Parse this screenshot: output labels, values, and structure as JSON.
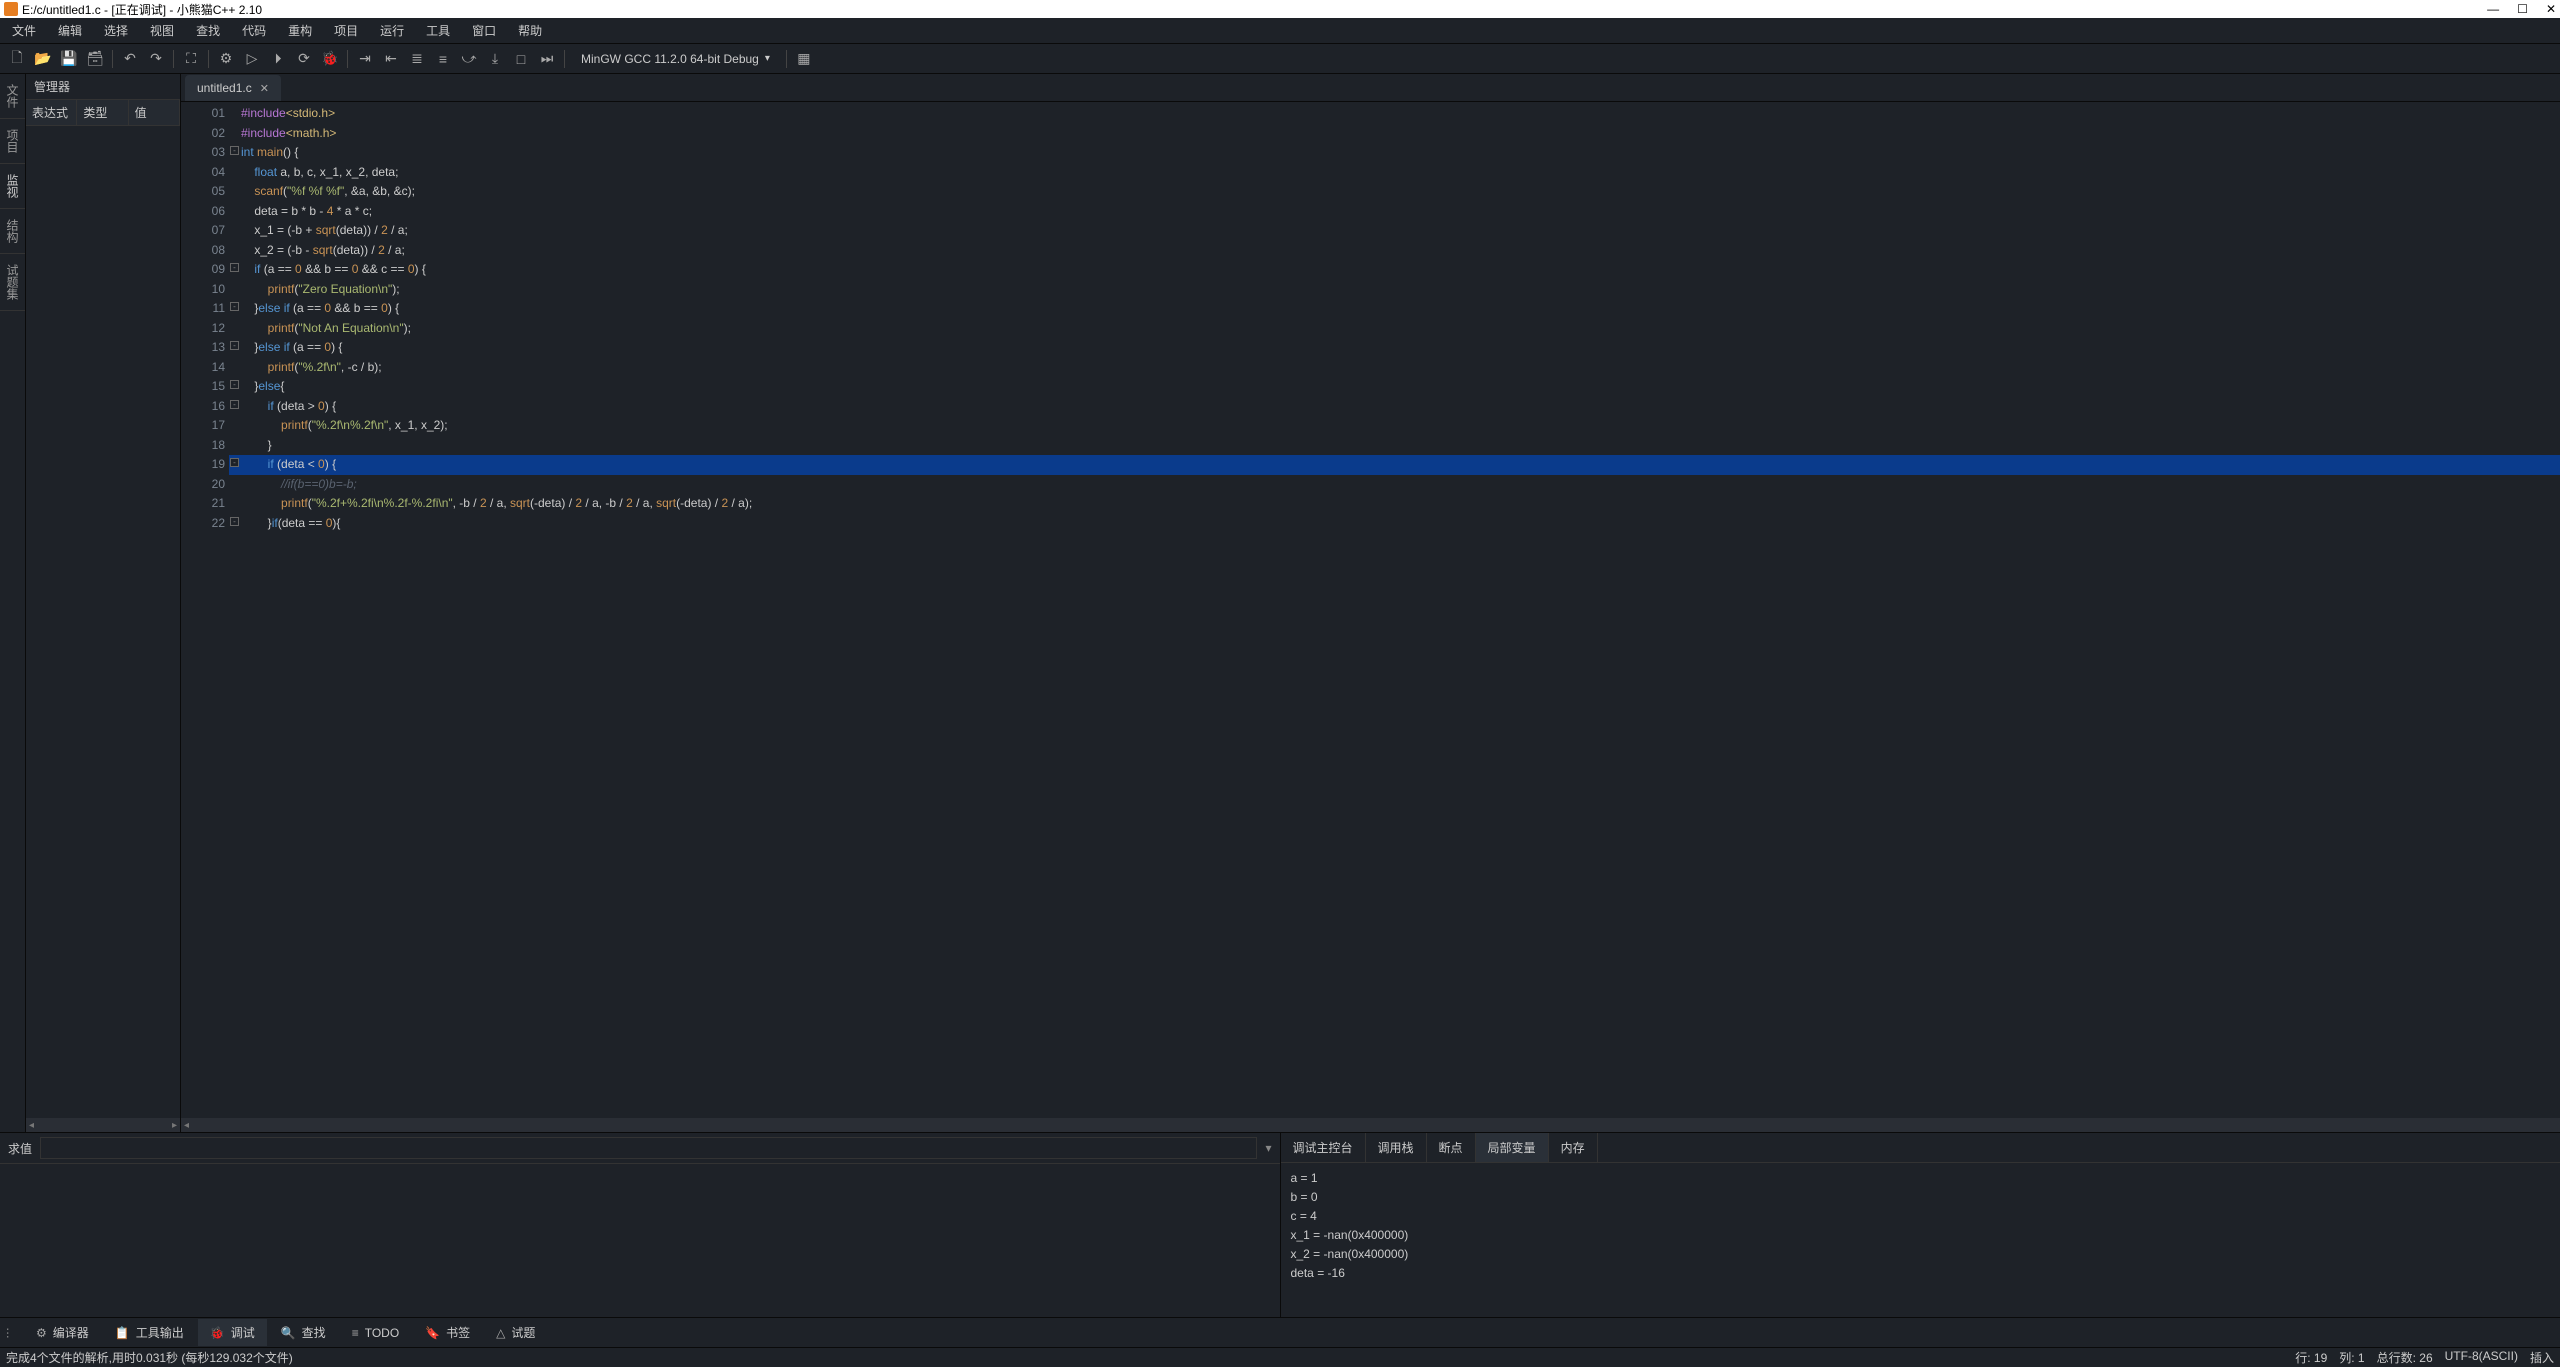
{
  "title": "E:/c/untitled1.c - [正在调试] - 小熊猫C++ 2.10",
  "menu": [
    "文件",
    "编辑",
    "选择",
    "视图",
    "查找",
    "代码",
    "重构",
    "项目",
    "运行",
    "工具",
    "窗口",
    "帮助"
  ],
  "compiler": "MinGW GCC 11.2.0 64-bit Debug",
  "manager": {
    "title": "管理器",
    "cols": [
      "表达式",
      "类型",
      "值"
    ]
  },
  "vtabs": [
    "文件",
    "项目",
    "监视",
    "结构",
    "试题集"
  ],
  "tab": {
    "name": "untitled1.c"
  },
  "lines": [
    {
      "n": "01",
      "fold": "",
      "h": [
        [
          "pp",
          "#include"
        ],
        [
          "inc",
          "<stdio.h>"
        ]
      ]
    },
    {
      "n": "02",
      "fold": "",
      "h": [
        [
          "pp",
          "#include"
        ],
        [
          "inc",
          "<math.h>"
        ]
      ]
    },
    {
      "n": "03",
      "fold": "-",
      "h": [
        [
          "ty",
          "int "
        ],
        [
          "fn",
          "main"
        ],
        [
          "op",
          "() {"
        ]
      ]
    },
    {
      "n": "04",
      "fold": "",
      "h": [
        [
          "guide",
          "    "
        ],
        [
          "ty",
          "float "
        ],
        [
          "id",
          "a, b, c, x_1, x_2, deta;"
        ]
      ]
    },
    {
      "n": "05",
      "fold": "",
      "h": [
        [
          "guide",
          "    "
        ],
        [
          "fn",
          "scanf"
        ],
        [
          "op",
          "("
        ],
        [
          "str",
          "\"%f %f %f\""
        ],
        [
          "op",
          ", &a, &b, &c);"
        ]
      ]
    },
    {
      "n": "06",
      "fold": "",
      "h": [
        [
          "guide",
          "    "
        ],
        [
          "id",
          "deta = b * b - "
        ],
        [
          "num",
          "4"
        ],
        [
          "id",
          " * a * c;"
        ]
      ]
    },
    {
      "n": "07",
      "fold": "",
      "h": [
        [
          "guide",
          "    "
        ],
        [
          "id",
          "x_1 = (-b + "
        ],
        [
          "fn",
          "sqrt"
        ],
        [
          "op",
          "("
        ],
        [
          "id",
          "deta"
        ],
        [
          "op",
          ")) / "
        ],
        [
          "num",
          "2"
        ],
        [
          "id",
          " / a;"
        ]
      ]
    },
    {
      "n": "08",
      "fold": "",
      "h": [
        [
          "guide",
          "    "
        ],
        [
          "id",
          "x_2 = (-b - "
        ],
        [
          "fn",
          "sqrt"
        ],
        [
          "op",
          "("
        ],
        [
          "id",
          "deta"
        ],
        [
          "op",
          ")) / "
        ],
        [
          "num",
          "2"
        ],
        [
          "id",
          " / a;"
        ]
      ]
    },
    {
      "n": "09",
      "fold": "-",
      "h": [
        [
          "guide",
          "    "
        ],
        [
          "kw",
          "if "
        ],
        [
          "op",
          "("
        ],
        [
          "id",
          "a == "
        ],
        [
          "num",
          "0"
        ],
        [
          "id",
          " && b == "
        ],
        [
          "num",
          "0"
        ],
        [
          "id",
          " && c == "
        ],
        [
          "num",
          "0"
        ],
        [
          "op",
          ") {"
        ]
      ]
    },
    {
      "n": "10",
      "fold": "",
      "h": [
        [
          "guide",
          "        "
        ],
        [
          "fn",
          "printf"
        ],
        [
          "op",
          "("
        ],
        [
          "str",
          "\"Zero Equation\\n\""
        ],
        [
          "op",
          ");"
        ]
      ]
    },
    {
      "n": "11",
      "fold": "-",
      "h": [
        [
          "guide",
          "    "
        ],
        [
          "op",
          "}"
        ],
        [
          "kw",
          "else if "
        ],
        [
          "op",
          "("
        ],
        [
          "id",
          "a == "
        ],
        [
          "num",
          "0"
        ],
        [
          "id",
          " && b == "
        ],
        [
          "num",
          "0"
        ],
        [
          "op",
          ") {"
        ]
      ]
    },
    {
      "n": "12",
      "fold": "",
      "h": [
        [
          "guide",
          "        "
        ],
        [
          "fn",
          "printf"
        ],
        [
          "op",
          "("
        ],
        [
          "str",
          "\"Not An Equation\\n\""
        ],
        [
          "op",
          ");"
        ]
      ]
    },
    {
      "n": "13",
      "fold": "-",
      "h": [
        [
          "guide",
          "    "
        ],
        [
          "op",
          "}"
        ],
        [
          "kw",
          "else if "
        ],
        [
          "op",
          "("
        ],
        [
          "id",
          "a == "
        ],
        [
          "num",
          "0"
        ],
        [
          "op",
          ") {"
        ]
      ]
    },
    {
      "n": "14",
      "fold": "",
      "h": [
        [
          "guide",
          "        "
        ],
        [
          "fn",
          "printf"
        ],
        [
          "op",
          "("
        ],
        [
          "str",
          "\"%.2f\\n\""
        ],
        [
          "op",
          ", -c / b);"
        ]
      ]
    },
    {
      "n": "15",
      "fold": "-",
      "h": [
        [
          "guide",
          "    "
        ],
        [
          "op",
          "}"
        ],
        [
          "kw",
          "else"
        ],
        [
          "op",
          "{"
        ]
      ]
    },
    {
      "n": "16",
      "fold": "-",
      "h": [
        [
          "guide",
          "        "
        ],
        [
          "kw",
          "if "
        ],
        [
          "op",
          "("
        ],
        [
          "id",
          "deta > "
        ],
        [
          "num",
          "0"
        ],
        [
          "op",
          ") {"
        ]
      ]
    },
    {
      "n": "17",
      "fold": "",
      "h": [
        [
          "guide",
          "            "
        ],
        [
          "fn",
          "printf"
        ],
        [
          "op",
          "("
        ],
        [
          "str",
          "\"%.2f\\n%.2f\\n\""
        ],
        [
          "op",
          ", x_1, x_2);"
        ]
      ]
    },
    {
      "n": "18",
      "fold": "",
      "h": [
        [
          "guide",
          "        "
        ],
        [
          "op",
          "}"
        ]
      ]
    },
    {
      "n": "19",
      "fold": "-",
      "bp": true,
      "hl": true,
      "h": [
        [
          "guide",
          "        "
        ],
        [
          "kw",
          "if "
        ],
        [
          "op",
          "("
        ],
        [
          "id",
          "deta < "
        ],
        [
          "num",
          "0"
        ],
        [
          "op",
          ") {"
        ]
      ]
    },
    {
      "n": "20",
      "fold": "",
      "h": [
        [
          "guide",
          "            "
        ],
        [
          "cm",
          "//if(b==0)b=-b;"
        ]
      ]
    },
    {
      "n": "21",
      "fold": "",
      "h": [
        [
          "guide",
          "            "
        ],
        [
          "fn",
          "printf"
        ],
        [
          "op",
          "("
        ],
        [
          "str",
          "\"%.2f+%.2fi\\n%.2f-%.2fi\\n\""
        ],
        [
          "op",
          ", -b / "
        ],
        [
          "num",
          "2"
        ],
        [
          "op",
          " / a, "
        ],
        [
          "fn",
          "sqrt"
        ],
        [
          "op",
          "(-deta) / "
        ],
        [
          "num",
          "2"
        ],
        [
          "op",
          " / a, -b / "
        ],
        [
          "num",
          "2"
        ],
        [
          "op",
          " / a, "
        ],
        [
          "fn",
          "sqrt"
        ],
        [
          "op",
          "(-deta) / "
        ],
        [
          "num",
          "2"
        ],
        [
          "op",
          " / a);"
        ]
      ]
    },
    {
      "n": "22",
      "fold": "-",
      "h": [
        [
          "guide",
          "        "
        ],
        [
          "op",
          "}"
        ],
        [
          "kw",
          "if"
        ],
        [
          "op",
          "("
        ],
        [
          "id",
          "deta == "
        ],
        [
          "num",
          "0"
        ],
        [
          "op",
          "){"
        ]
      ]
    }
  ],
  "eval_label": "求值",
  "dtabs": [
    "调试主控台",
    "调用栈",
    "断点",
    "局部变量",
    "内存"
  ],
  "dtab_active": 3,
  "vars": [
    "a = 1",
    "b = 0",
    "c = 4",
    "x_1 = -nan(0x400000)",
    "x_2 = -nan(0x400000)",
    "deta = -16"
  ],
  "btabs": [
    {
      "ic": "⚙",
      "l": "编译器"
    },
    {
      "ic": "📋",
      "l": "工具输出"
    },
    {
      "ic": "🐞",
      "l": "调试",
      "act": true
    },
    {
      "ic": "🔍",
      "l": "查找"
    },
    {
      "ic": "≡",
      "l": "TODO"
    },
    {
      "ic": "🔖",
      "l": "书签"
    },
    {
      "ic": "△",
      "l": "试题"
    }
  ],
  "status_left": "完成4个文件的解析,用时0.031秒 (每秒129.032个文件)",
  "status_right": [
    "行: 19",
    "列: 1",
    "总行数: 26",
    "UTF-8(ASCII)",
    "插入"
  ]
}
